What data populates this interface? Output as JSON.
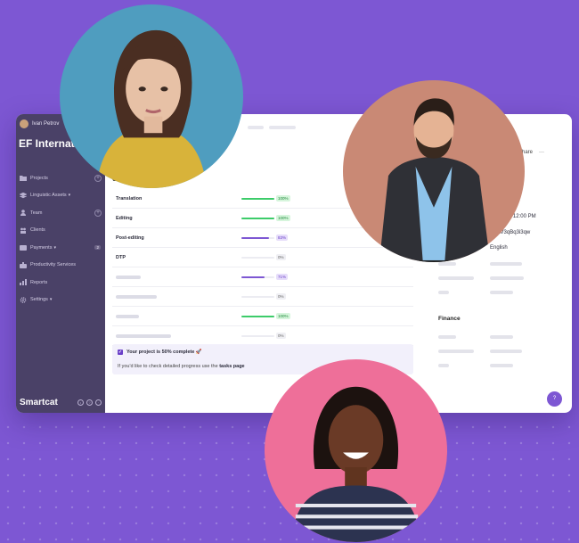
{
  "user": {
    "name": "Ivan Petrov"
  },
  "org": {
    "name": "EF Internation"
  },
  "sidebar": {
    "items": [
      {
        "label": "Projects",
        "icon": "folder-icon",
        "action": "plus"
      },
      {
        "label": "Linguistic Assets",
        "icon": "layers-icon",
        "caret": "▾"
      },
      {
        "label": "Team",
        "icon": "person-icon",
        "action": "plus"
      },
      {
        "label": "Clients",
        "icon": "people-icon"
      },
      {
        "label": "Payments",
        "icon": "wallet-icon",
        "caret": "▾",
        "badge": "2"
      },
      {
        "label": "Productivity Services",
        "icon": "briefcase-icon"
      },
      {
        "label": "Reports",
        "icon": "chart-icon"
      },
      {
        "label": "Settings",
        "icon": "gear-icon",
        "caret": "▾"
      }
    ],
    "brand": "Smartcat"
  },
  "header": {
    "share_label": "Share",
    "more_label": "···"
  },
  "progress": {
    "section_title": "Cur",
    "rows": [
      {
        "label": "Translation",
        "percent": "100%",
        "fraction": 1.0,
        "color": "#3dcc6a",
        "style": "green"
      },
      {
        "label": "Editing",
        "percent": "100%",
        "fraction": 1.0,
        "color": "#3dcc6a",
        "style": "green"
      },
      {
        "label": "Post-editing",
        "percent": "83%",
        "fraction": 0.83,
        "color": "#7d57d3",
        "style": "purple"
      },
      {
        "label": "DTP",
        "percent": "0%",
        "fraction": 0.0,
        "color": "#cccccc",
        "style": "gray"
      },
      {
        "label": "",
        "percent": "71%",
        "fraction": 0.71,
        "color": "#7d57d3",
        "style": "purple"
      },
      {
        "label": "",
        "percent": "0%",
        "fraction": 0.0,
        "color": "#cccccc",
        "style": "gray"
      },
      {
        "label": "",
        "percent": "100%",
        "fraction": 1.0,
        "color": "#3dcc6a",
        "style": "green"
      },
      {
        "label": "",
        "percent": "0%",
        "fraction": 0.0,
        "color": "#cccccc",
        "style": "gray"
      }
    ]
  },
  "notice": {
    "title": "Your project is 50% complete 🚀",
    "body_prefix": "If you'd like to check detailed progress use the",
    "link_label": "tasks page"
  },
  "details": {
    "time": "11 12:00 PM",
    "code": "AV3qBq3i3qw",
    "language": "English",
    "finance_title": "Finance"
  },
  "help": {
    "label": "?"
  },
  "colors": {
    "accent": "#7d57d3",
    "sidebar": "#4a4167",
    "green": "#3dcc6a"
  }
}
